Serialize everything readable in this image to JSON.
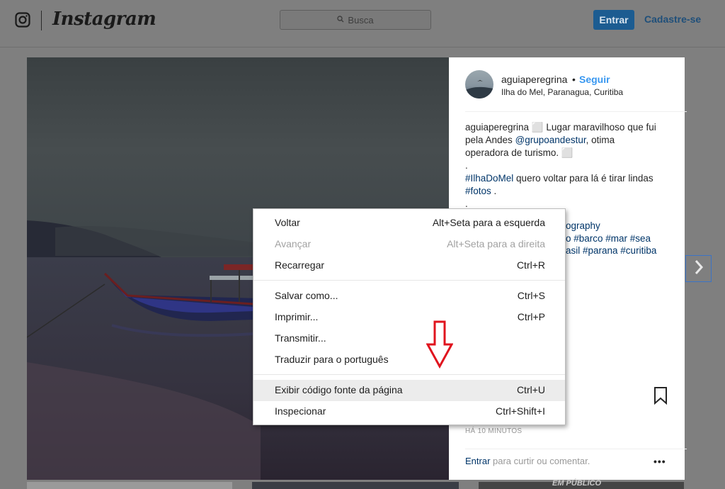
{
  "header": {
    "brand": "Instagram",
    "search_placeholder": "Busca",
    "login_label": "Entrar",
    "signup_label": "Cadastre-se"
  },
  "post": {
    "username": "aguiaperegrina",
    "separator": "•",
    "follow_label": "Seguir",
    "location": "Ilha do Mel, Paranagua, Curitiba",
    "caption": {
      "line1": "aguiaperegrina ⬜ Lugar maravilhoso que fui",
      "line2_pre": "pela Andes ",
      "line2_mention": "@grupoandestur",
      "line2_post": ", otima",
      "line3": "operadora de turismo. ⬜",
      "dot1": ".",
      "line5_tag": "#IlhaDoMel",
      "line5_post": " quero voltar para lá é tirar lindas",
      "line6_tag": "#fotos",
      "line6_post": " .",
      "dot2": ".",
      "frag1": "ography",
      "frag2": "o #barco #mar #sea",
      "frag3": "asil #parana #curitiba"
    },
    "time_ago": "HÁ 10 MINUTOS",
    "comment_link": "Entrar",
    "comment_text": " para curtir ou comentar.",
    "more": "•••"
  },
  "thumbs": {
    "overlay_text": "EM PÚBLICO"
  },
  "context_menu": {
    "items": [
      {
        "label": "Voltar",
        "shortcut": "Alt+Seta para a esquerda",
        "enabled": true
      },
      {
        "label": "Avançar",
        "shortcut": "Alt+Seta para a direita",
        "enabled": false
      },
      {
        "label": "Recarregar",
        "shortcut": "Ctrl+R",
        "enabled": true
      },
      {
        "label": "Salvar como...",
        "shortcut": "Ctrl+S",
        "enabled": true
      },
      {
        "label": "Imprimir...",
        "shortcut": "Ctrl+P",
        "enabled": true
      },
      {
        "label": "Transmitir...",
        "shortcut": "",
        "enabled": true
      },
      {
        "label": "Traduzir para o português",
        "shortcut": "",
        "enabled": true
      },
      {
        "label": "Exibir código fonte da página",
        "shortcut": "Ctrl+U",
        "enabled": true,
        "highlighted": true
      },
      {
        "label": "Inspecionar",
        "shortcut": "Ctrl+Shift+I",
        "enabled": true
      }
    ]
  },
  "colors": {
    "overlay": "#7f7f7f",
    "login_button": "#1c5c91",
    "follow": "#3897f0",
    "hashtag": "#003569",
    "annotation_arrow": "#e0141e"
  }
}
